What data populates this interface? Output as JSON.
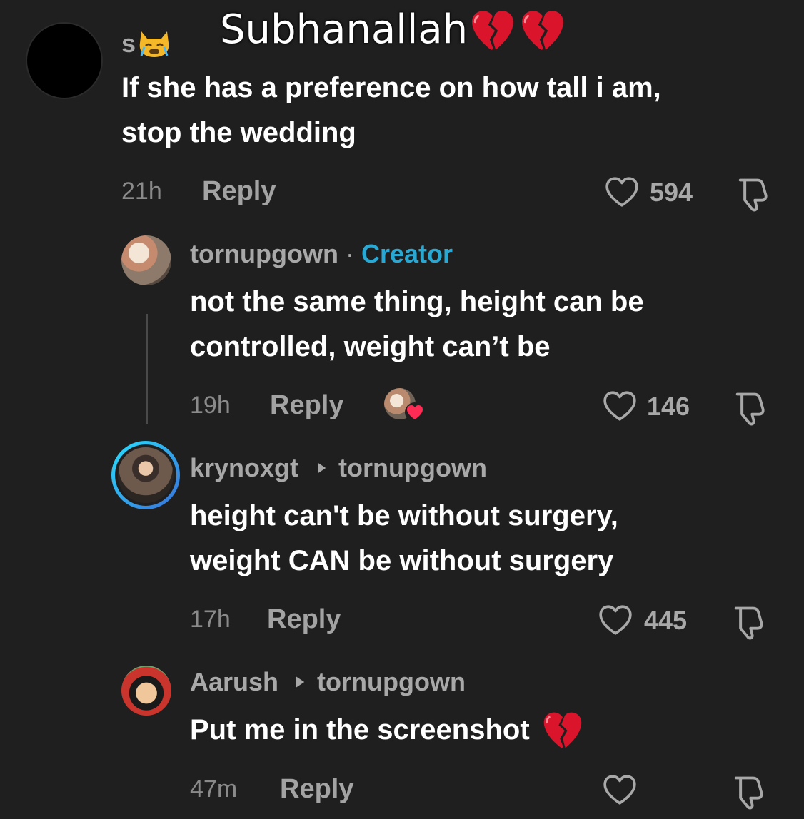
{
  "overlay": {
    "caption": "Subhanallah"
  },
  "comments": [
    {
      "username": "s",
      "text_lines": [
        "If she has a preference on how tall i am,",
        "stop the wedding"
      ],
      "time": "21h",
      "reply_label": "Reply",
      "likes": "594"
    },
    {
      "username": "tornupgown",
      "separator": "·",
      "badge": "Creator",
      "text_lines": [
        "not the same thing, height can be",
        "controlled, weight can’t be"
      ],
      "time": "19h",
      "reply_label": "Reply",
      "likes": "146"
    },
    {
      "username": "krynoxgt",
      "reply_to": "tornupgown",
      "text_lines": [
        "height can't be without surgery,",
        "weight CAN be without surgery"
      ],
      "time": "17h",
      "reply_label": "Reply",
      "likes": "445"
    },
    {
      "username": "Aarush",
      "reply_to": "tornupgown",
      "text_lines": [
        "Put me in the screenshot"
      ],
      "time": "47m",
      "reply_label": "Reply",
      "likes": ""
    }
  ],
  "icons": {
    "like": "heart-outline-icon",
    "dislike": "thumbs-down-icon",
    "broken_heart": "broken-heart-emoji",
    "reply_arrow": "triangle-right-icon",
    "crying_cat": "crying-cat-emoji"
  },
  "colors": {
    "background": "#1f1f1f",
    "creator_badge": "#2aa8d4",
    "broken_heart": "#d9142b",
    "story_ring_start": "#28e0ff",
    "story_ring_end": "#3a6fd8"
  }
}
